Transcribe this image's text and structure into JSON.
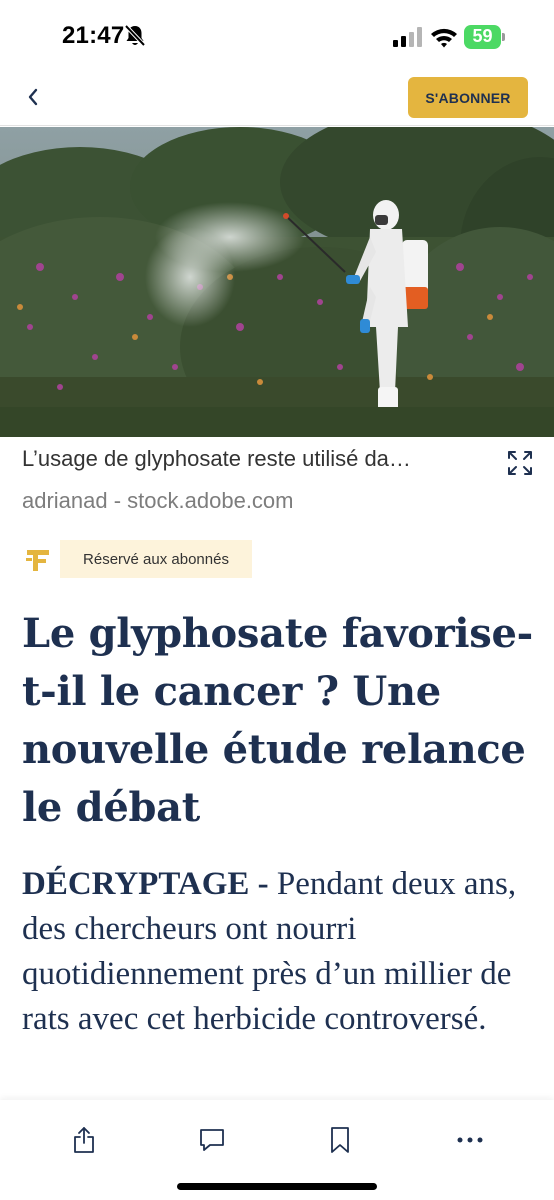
{
  "status_bar": {
    "time": "21:47",
    "battery_percent": "59",
    "icons": [
      "bell-slash-icon",
      "signal-icon",
      "wifi-icon",
      "battery-icon"
    ]
  },
  "nav": {
    "back_icon": "chevron-left-icon",
    "subscribe_label": "S'ABONNER"
  },
  "hero": {
    "caption": "L’usage de glyphosate reste utilisé da…",
    "credit": "adrianad - stock.adobe.com",
    "expand_icon": "expand-icon"
  },
  "article": {
    "premium_label": "Réservé aux abonnés",
    "headline": "Le glyphosate favorise-t-il le cancer ? Une nouvelle étude relance le débat",
    "lead_kicker": "DÉCRYPTAGE -",
    "lead_text": " Pendant deux ans, des chercheurs ont nourri quotidiennement près d’un millier de rats avec cet herbicide controversé."
  },
  "toolbar": {
    "items": [
      "share-icon",
      "comment-icon",
      "bookmark-icon",
      "more-icon"
    ]
  },
  "colors": {
    "accent": "#e4b53f",
    "navy": "#1e3050",
    "premium_bg": "#fdf3db",
    "battery": "#4cd964"
  }
}
